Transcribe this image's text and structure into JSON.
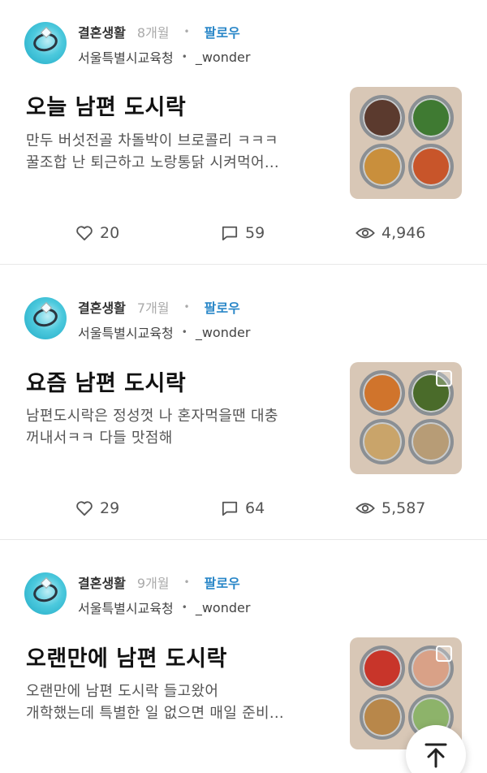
{
  "posts": [
    {
      "category": "결혼생활",
      "time": "8개월",
      "follow_label": "팔로우",
      "author_org": "서울특별시교육청",
      "author_name": "_wonder",
      "title": "오늘 남편 도시락",
      "excerpt_line1": "만두 버섯전골 차돌박이 브로콜리 ㅋㅋㅋ",
      "excerpt_line2": "꿀조합  난 퇴근하고 노랑통닭 시켜먹어...",
      "likes": "20",
      "comments": "59",
      "views": "4,946",
      "thumb_colors": [
        "#5b3a2e",
        "#3f7a32",
        "#c98f3c",
        "#c8552a"
      ],
      "thumb_multi": false
    },
    {
      "category": "결혼생활",
      "time": "7개월",
      "follow_label": "팔로우",
      "author_org": "서울특별시교육청",
      "author_name": "_wonder",
      "title": "요즘 남편 도시락",
      "excerpt_line1": "남편도시락은 정성껏 나 혼자먹을땐 대충",
      "excerpt_line2": "꺼내서ㅋㅋ  다들 맛점해",
      "likes": "29",
      "comments": "64",
      "views": "5,587",
      "thumb_colors": [
        "#d0742c",
        "#4a6b2a",
        "#c9a46a",
        "#b79c76"
      ],
      "thumb_multi": true
    },
    {
      "category": "결혼생활",
      "time": "9개월",
      "follow_label": "팔로우",
      "author_org": "서울특별시교육청",
      "author_name": "_wonder",
      "title": "오랜만에 남편 도시락",
      "excerpt_line1": "오랜만에 남편 도시락 들고왔어",
      "excerpt_line2": "개학했는데 특별한 일 없으면 매일 준비...",
      "likes": "",
      "comments": "",
      "views": "",
      "thumb_colors": [
        "#c8352a",
        "#d9a187",
        "#b8874a",
        "#8db36a"
      ],
      "thumb_multi": true
    }
  ],
  "icons": {
    "like": "heart-icon",
    "comment": "comment-icon",
    "view": "eye-icon",
    "scroll_top": "arrow-up-to-top-icon"
  },
  "colors": {
    "follow": "#2a87c8",
    "time": "#aaaaaa"
  }
}
